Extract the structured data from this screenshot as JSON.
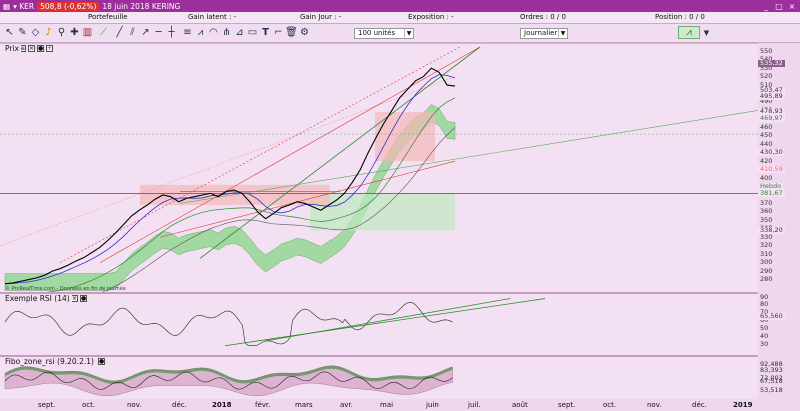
{
  "window": {
    "ticker": "KER",
    "price_change": "508,8 (-0,62%)",
    "date_name": "18 juin 2018 KERING",
    "controls": [
      "_",
      "□",
      "×"
    ]
  },
  "topbar": {
    "portefeuille": "Portefeuille",
    "gain_latent": "Gain latent : -",
    "gain_jour": "Gain Jour : -",
    "exposition": "Exposition : -",
    "ordres": "Ordres : 0 / 0",
    "position": "Position : 0 / 0"
  },
  "toolbar": {
    "quantity": "100 unités",
    "period": "Journalier",
    "tools": [
      "cursor-icon",
      "pencil-icon",
      "eraser-icon",
      "bell-icon",
      "zoom-icon",
      "crosshair-icon",
      "bars-icon",
      "line-icon",
      "trendline-icon",
      "channel-icon",
      "ray-icon",
      "hline-icon",
      "vline-icon",
      "fibo-retracement-icon",
      "fibo-fan-icon",
      "fibo-arc-icon",
      "pitchfork-icon",
      "gann-icon",
      "rectangle-icon",
      "text-icon",
      "brush-icon",
      "trash-icon",
      "settings-icon",
      "mini-chart-icon"
    ]
  },
  "panels": {
    "price": {
      "label": "Prix"
    },
    "rsi": {
      "label": "Exemple RSI (14)"
    },
    "fibo": {
      "label": "Fibo_zone_rsi (9.20.2.1)"
    }
  },
  "copyright": "© ProRealTime.com - Données en fin de journée",
  "price_axis": {
    "ticks": [
      "550",
      "540",
      "530",
      "520",
      "510",
      "500",
      "490",
      "480",
      "470",
      "460",
      "450",
      "440",
      "430",
      "420",
      "410",
      "400",
      "390",
      "380",
      "370",
      "360",
      "350",
      "340",
      "330",
      "320",
      "310",
      "300",
      "290",
      "280"
    ],
    "tags": [
      {
        "text": "535,32",
        "color": "#ffffff",
        "bg": "#8a5f8a"
      },
      {
        "text": "503,47",
        "color": "#333333",
        "bg": "#f7e0f7"
      },
      {
        "text": "495,89",
        "color": "#333333",
        "bg": "#f7e0f7"
      },
      {
        "text": "478,93",
        "color": "#333333",
        "bg": "#f7e0f7"
      },
      {
        "text": "469,97",
        "color": "#2d8a2d",
        "bg": "#f7e0f7"
      },
      {
        "text": "430,30",
        "color": "#333333",
        "bg": "#f7e0f7"
      },
      {
        "text": "410,59",
        "color": "#ee6a6a",
        "bg": "#f7e0f7"
      },
      {
        "text": "Hebdo",
        "color": "#2d8a2d",
        "bg": "#f7e0f7"
      },
      {
        "text": "381,67",
        "color": "#2d8a2d",
        "bg": "#f7e0f7"
      },
      {
        "text": "338,20",
        "color": "#333333",
        "bg": "#f7e0f7"
      }
    ]
  },
  "rsi_axis": {
    "ticks": [
      "90",
      "80",
      "70",
      "60",
      "50",
      "40",
      "30"
    ],
    "value": "65,560"
  },
  "fibo_axis": {
    "values": [
      "92,488",
      "83,393",
      "72,002",
      "67,518",
      "53,518"
    ]
  },
  "xaxis": {
    "labels": [
      "sept.",
      "oct.",
      "nov.",
      "déc.",
      "2018",
      "févr.",
      "mars",
      "avr.",
      "mai",
      "juin",
      "juil.",
      "août",
      "sept.",
      "oct.",
      "nov.",
      "déc.",
      "2019"
    ]
  },
  "chart_data": {
    "type": "line",
    "title": "",
    "series": [
      {
        "values": [
          275,
          276,
          278,
          280,
          282,
          285,
          290,
          293,
          297,
          302,
          306,
          312,
          318,
          326,
          335,
          345,
          355,
          362,
          368,
          375,
          380,
          378,
          372,
          376,
          378,
          380,
          382,
          378,
          384,
          386,
          382,
          372,
          360,
          352,
          358,
          365,
          368,
          372,
          370,
          366,
          362,
          368,
          374,
          382,
          395,
          410,
          430,
          448,
          465,
          480,
          495,
          505,
          515,
          520,
          530,
          525,
          510,
          508.8
        ]
      }
    ],
    "ylim": [
      270,
      555
    ],
    "rsi": {
      "range": [
        20,
        90
      ],
      "last": 65.56
    },
    "fibo_zone_rsi": {
      "values": [
        92.488,
        83.393,
        72.002,
        67.518,
        53.518
      ]
    }
  }
}
